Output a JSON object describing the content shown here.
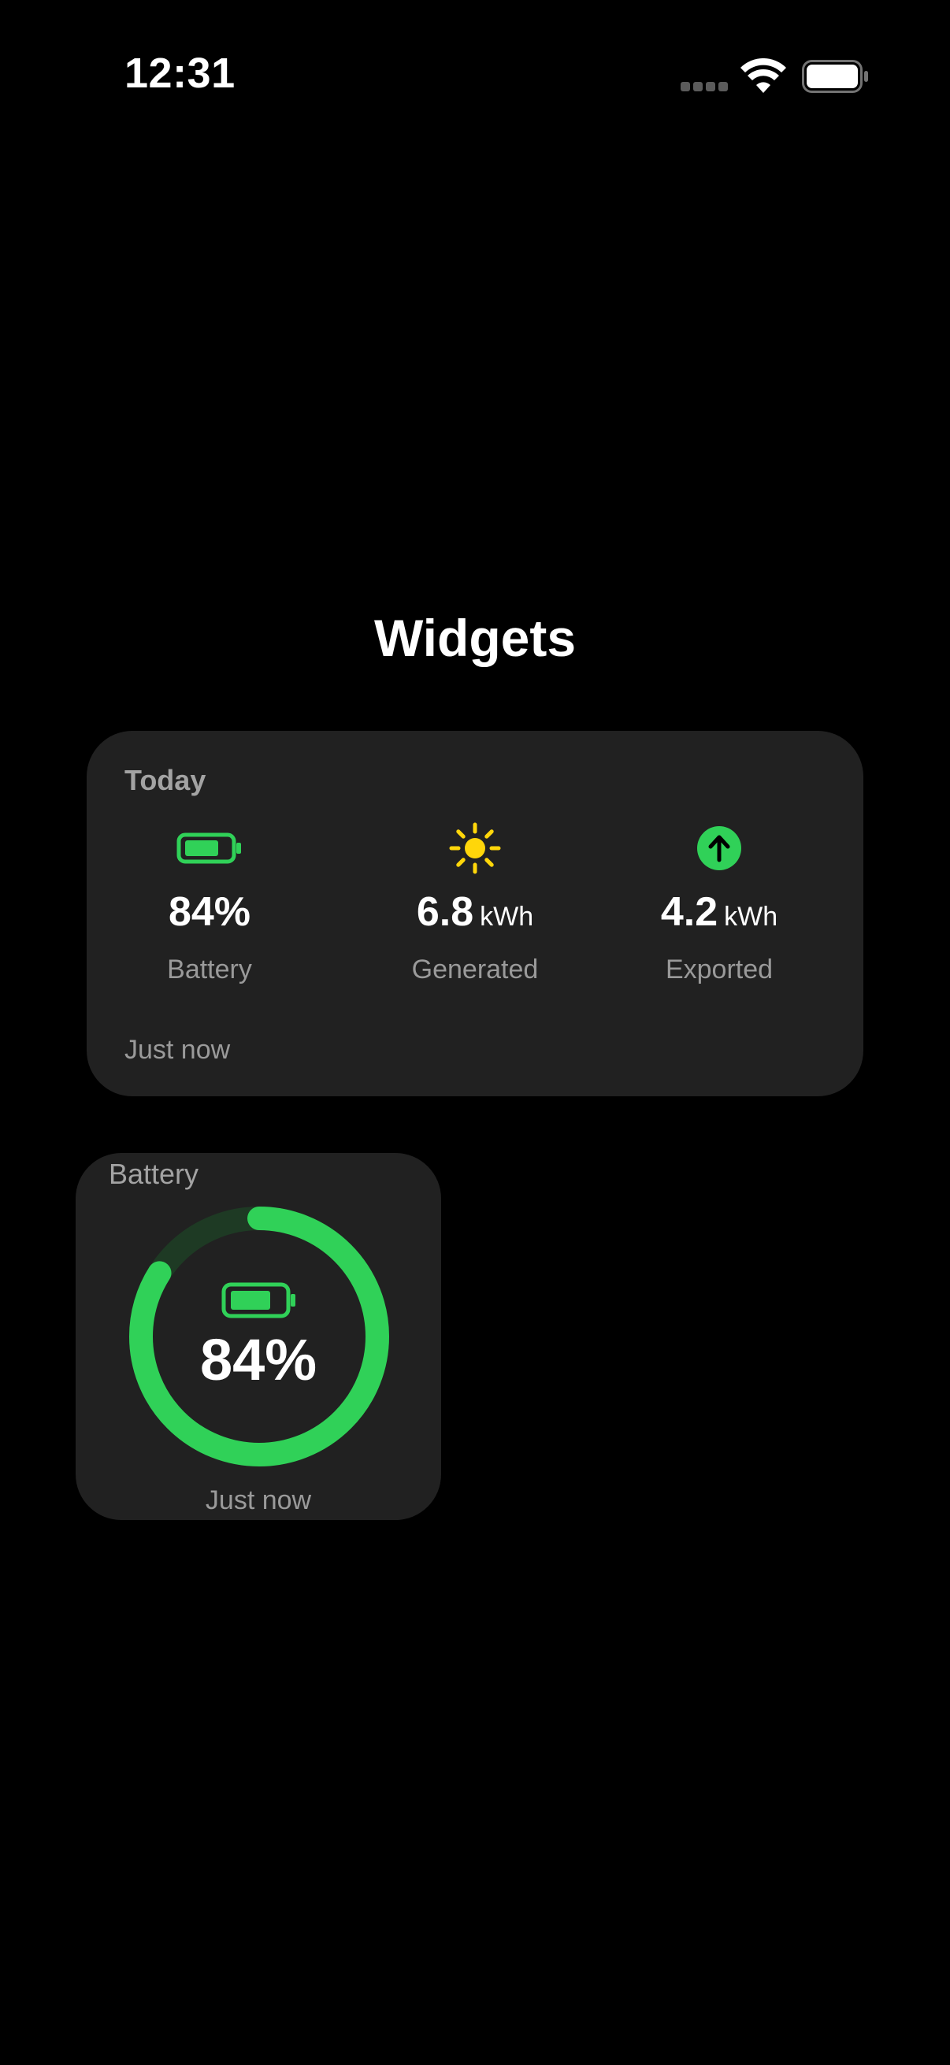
{
  "status_bar": {
    "time": "12:31",
    "icons": [
      "cellular-signal-icon",
      "wifi-icon",
      "battery-icon"
    ]
  },
  "page": {
    "title": "Widgets"
  },
  "widget_medium": {
    "heading": "Today",
    "stats": [
      {
        "icon": "battery-icon",
        "value": "84%",
        "unit": "",
        "label": "Battery",
        "icon_color": "#30d158"
      },
      {
        "icon": "sun-icon",
        "value": "6.8",
        "unit": "kWh",
        "label": "Generated",
        "icon_color": "#ffd60a"
      },
      {
        "icon": "arrow-up-circle-icon",
        "value": "4.2",
        "unit": "kWh",
        "label": "Exported",
        "icon_color": "#30d158"
      }
    ],
    "footer": "Just now"
  },
  "widget_small": {
    "heading": "Battery",
    "value": "84%",
    "level": 0.84,
    "footer": "Just now"
  },
  "colors": {
    "background": "#000000",
    "card": "#212121",
    "accent_green": "#30d158",
    "ring_track": "#1e3a24",
    "sun_yellow": "#ffd60a",
    "secondary_text": "#9a9a9a"
  }
}
